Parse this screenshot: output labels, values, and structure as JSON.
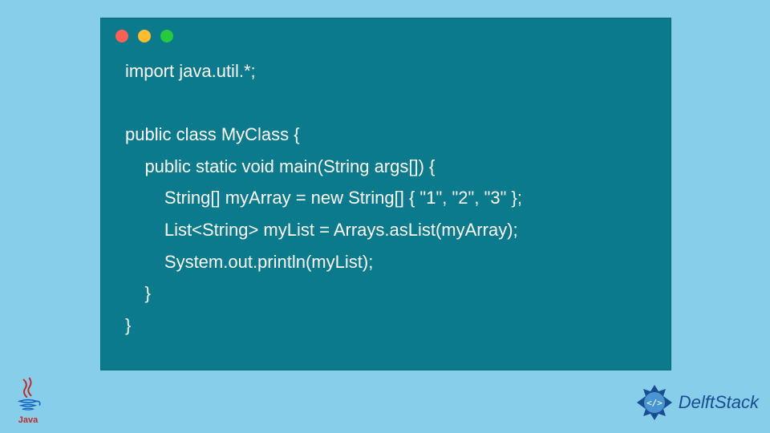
{
  "code": {
    "lines": [
      "import java.util.*;",
      "",
      "public class MyClass {",
      "    public static void main(String args[]) {",
      "        String[] myArray = new String[] { \"1\", \"2\", \"3\" };",
      "        List<String> myList = Arrays.asList(myArray);",
      "        System.out.println(myList);",
      "    }",
      "}"
    ]
  },
  "java_label": "Java",
  "delft_label": "DelftStack"
}
